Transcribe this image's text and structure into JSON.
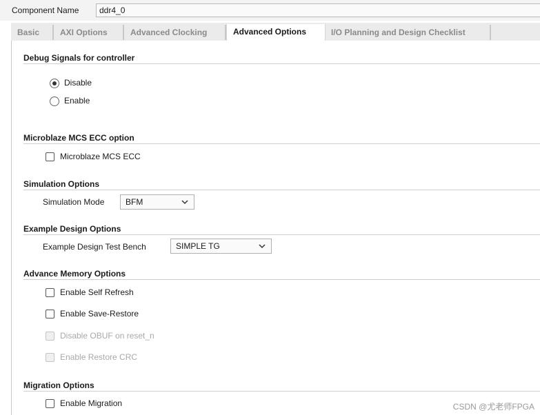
{
  "component": {
    "label": "Component Name",
    "value": "ddr4_0"
  },
  "tabs": [
    {
      "label": "Basic",
      "active": false
    },
    {
      "label": "AXI Options",
      "active": false
    },
    {
      "label": "Advanced Clocking",
      "active": false
    },
    {
      "label": "Advanced Options",
      "active": true
    },
    {
      "label": "I/O Planning and Design Checklist",
      "active": false
    }
  ],
  "debug": {
    "title": "Debug Signals for controller",
    "options": [
      {
        "label": "Disable",
        "selected": true
      },
      {
        "label": "Enable",
        "selected": false
      }
    ]
  },
  "microblaze": {
    "title": "Microblaze MCS ECC option",
    "checkbox": "Microblaze MCS ECC"
  },
  "simulation": {
    "title": "Simulation Options",
    "field_label": "Simulation Mode",
    "value": "BFM"
  },
  "example": {
    "title": "Example Design Options",
    "field_label": "Example Design Test Bench",
    "value": "SIMPLE TG"
  },
  "advance_memory": {
    "title": "Advance Memory Options",
    "options": [
      {
        "label": "Enable Self Refresh",
        "disabled": false
      },
      {
        "label": "Enable Save-Restore",
        "disabled": false
      },
      {
        "label": "Disable OBUF on reset_n",
        "disabled": true
      },
      {
        "label": "Enable Restore CRC",
        "disabled": true
      }
    ]
  },
  "migration": {
    "title": "Migration Options",
    "checkbox": "Enable Migration"
  },
  "watermark": "CSDN @尤老师FPGA"
}
